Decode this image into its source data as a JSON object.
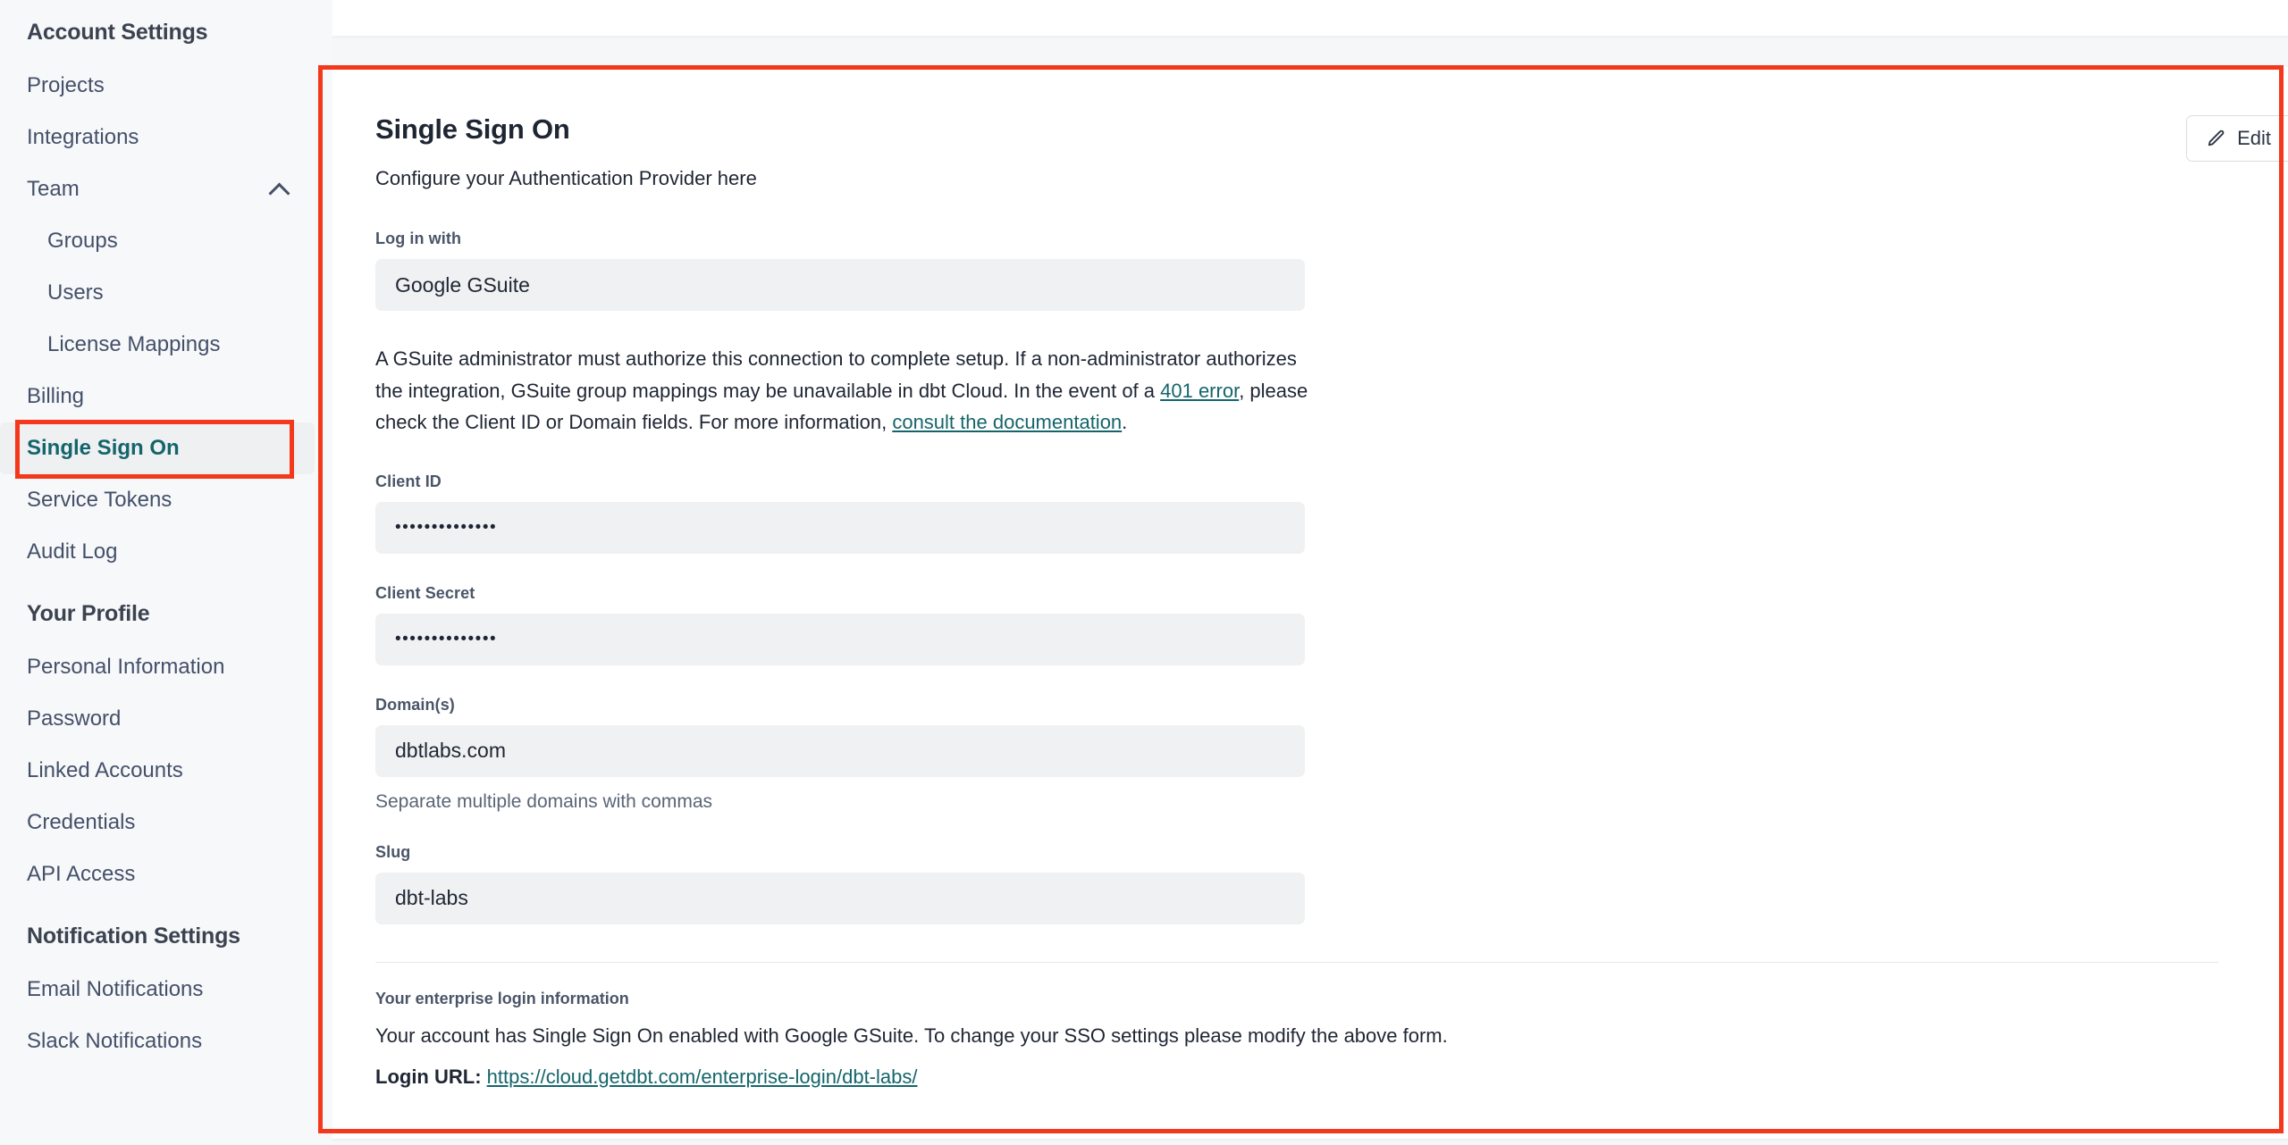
{
  "sidebar": {
    "sections": [
      {
        "title": "Account Settings",
        "items": [
          {
            "label": "Projects",
            "sub": false,
            "active": false,
            "chevron": false
          },
          {
            "label": "Integrations",
            "sub": false,
            "active": false,
            "chevron": false
          },
          {
            "label": "Team",
            "sub": false,
            "active": false,
            "chevron": true
          },
          {
            "label": "Groups",
            "sub": true,
            "active": false,
            "chevron": false
          },
          {
            "label": "Users",
            "sub": true,
            "active": false,
            "chevron": false
          },
          {
            "label": "License Mappings",
            "sub": true,
            "active": false,
            "chevron": false
          },
          {
            "label": "Billing",
            "sub": false,
            "active": false,
            "chevron": false
          },
          {
            "label": "Single Sign On",
            "sub": false,
            "active": true,
            "chevron": false
          },
          {
            "label": "Service Tokens",
            "sub": false,
            "active": false,
            "chevron": false
          },
          {
            "label": "Audit Log",
            "sub": false,
            "active": false,
            "chevron": false
          }
        ]
      },
      {
        "title": "Your Profile",
        "items": [
          {
            "label": "Personal Information",
            "sub": false,
            "active": false,
            "chevron": false
          },
          {
            "label": "Password",
            "sub": false,
            "active": false,
            "chevron": false
          },
          {
            "label": "Linked Accounts",
            "sub": false,
            "active": false,
            "chevron": false
          },
          {
            "label": "Credentials",
            "sub": false,
            "active": false,
            "chevron": false
          },
          {
            "label": "API Access",
            "sub": false,
            "active": false,
            "chevron": false
          }
        ]
      },
      {
        "title": "Notification Settings",
        "items": [
          {
            "label": "Email Notifications",
            "sub": false,
            "active": false,
            "chevron": false
          },
          {
            "label": "Slack Notifications",
            "sub": false,
            "active": false,
            "chevron": false
          }
        ]
      }
    ]
  },
  "main": {
    "title": "Single Sign On",
    "subtitle": "Configure your Authentication Provider here",
    "edit_button": "Edit",
    "fields": {
      "login_with": {
        "label": "Log in with",
        "value": "Google GSuite"
      },
      "client_id": {
        "label": "Client ID",
        "value": "••••••••••••••"
      },
      "client_secret": {
        "label": "Client Secret",
        "value": "••••••••••••••"
      },
      "domains": {
        "label": "Domain(s)",
        "value": "dbtlabs.com",
        "helper": "Separate multiple domains with commas"
      },
      "slug": {
        "label": "Slug",
        "value": "dbt-labs"
      }
    },
    "notice": {
      "part1": "A GSuite administrator must authorize this connection to complete setup. If a non-administrator authorizes the integration, GSuite group mappings may be unavailable in dbt Cloud. In the event of a ",
      "link1": "401 error",
      "part2": ", please check the Client ID or Domain fields. For more information, ",
      "link2": "consult the documentation",
      "part3": "."
    },
    "enterprise": {
      "label": "Your enterprise login information",
      "description": "Your account has Single Sign On enabled with Google GSuite. To change your SSO settings please modify the above form.",
      "url_label": "Login URL:",
      "url": "https://cloud.getdbt.com/enterprise-login/dbt-labs/"
    }
  },
  "annotations": {
    "color": "#f4381c",
    "main_panel_highlight": "Single Sign On settings panel",
    "sidebar_highlight": "Single Sign On nav item"
  },
  "colors": {
    "accent_teal": "#14656b",
    "annotation_red": "#f4381c",
    "sidebar_bg": "#f7f8f9",
    "field_bg": "#f0f1f3",
    "text_primary": "#1f2633"
  }
}
